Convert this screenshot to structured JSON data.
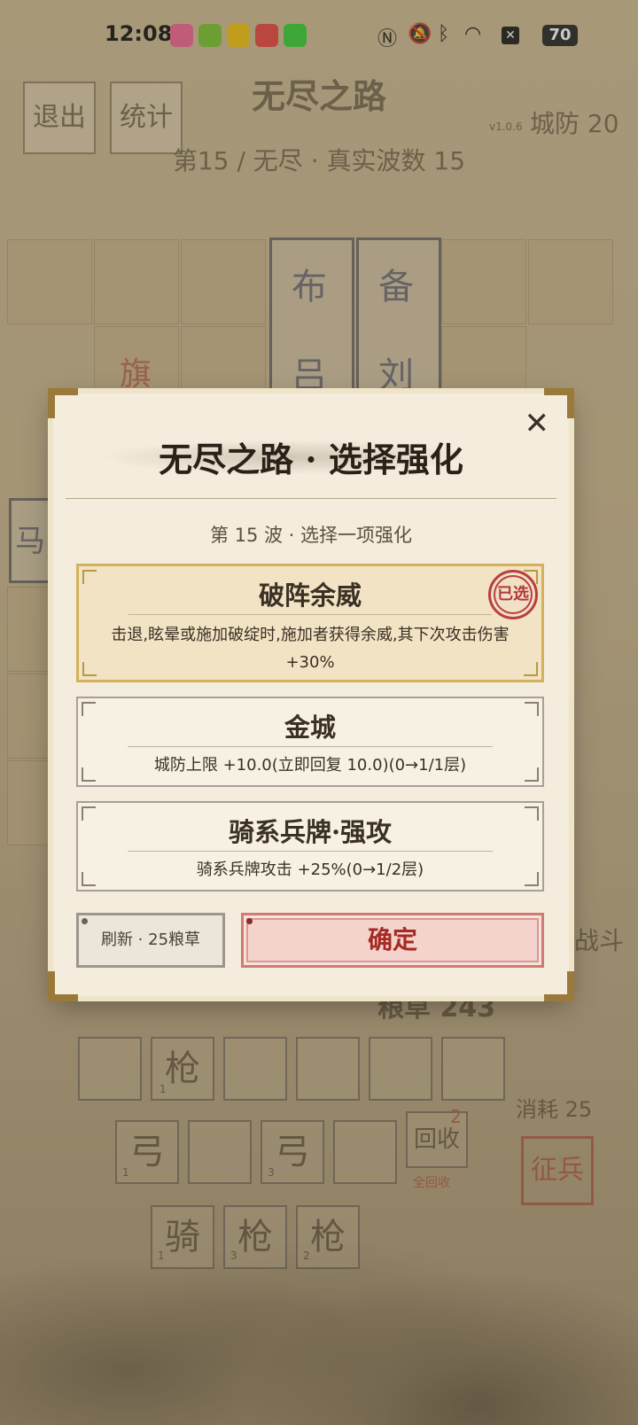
{
  "status_bar": {
    "time": "12:08",
    "battery": "70"
  },
  "game": {
    "exit_label": "退出",
    "stats_label": "统计",
    "title": "无尽之路",
    "version": "v1.0.6",
    "city_defense": "城防 20",
    "wave_line": "第15 / 无尽 · 真实波数 15",
    "grid_cards": [
      {
        "top": "布",
        "bottom": "吕"
      },
      {
        "top": "备",
        "bottom": "刘"
      }
    ],
    "flag_label": "旗",
    "left_card": "马",
    "grain": "粮草 243",
    "side_text": "战斗",
    "consume": "消耗 25",
    "recruit_label": "征兵",
    "recycle_label": "回收",
    "recycle_count": "2",
    "recycle_all_label": "全回收",
    "row1": [
      "",
      "枪",
      "",
      "",
      "",
      ""
    ],
    "row2": [
      "弓",
      "",
      "弓",
      ""
    ],
    "row3": [
      "骑",
      "枪",
      "枪"
    ],
    "row_nums": {
      "r1_1": "1",
      "r2_0": "1",
      "r2_2": "3",
      "r3_0": "1",
      "r3_1": "3",
      "r3_2": "2"
    }
  },
  "modal": {
    "title": "无尽之路 · 选择强化",
    "close_symbol": "✕",
    "subtitle": "第 15 波 · 选择一项强化",
    "options": [
      {
        "title": "破阵余威",
        "desc": "击退,眩晕或施加破绽时,施加者获得余威,其下次攻击伤害+30%",
        "selected": true,
        "badge": "已选"
      },
      {
        "title": "金城",
        "desc": "城防上限 +10.0(立即回复 10.0)(0→1/1层)",
        "selected": false
      },
      {
        "title": "骑系兵牌·强攻",
        "desc": "骑系兵牌攻击 +25%(0→1/2层)",
        "selected": false
      }
    ],
    "refresh_label": "刷新 · 25粮草",
    "confirm_label": "确定"
  }
}
